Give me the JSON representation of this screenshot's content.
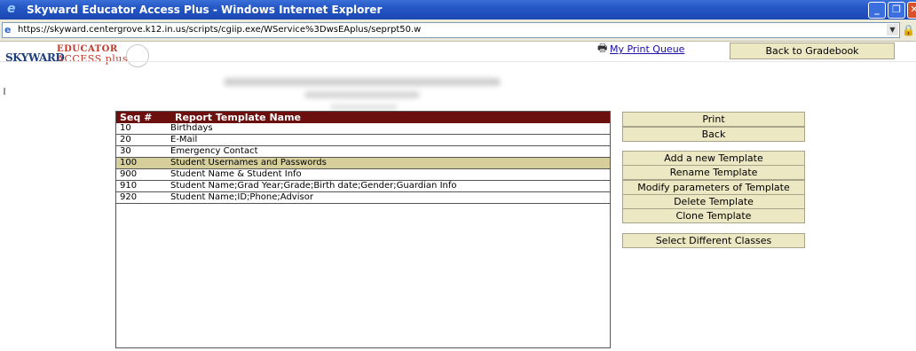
{
  "window": {
    "title": "Skyward Educator Access Plus - Windows Internet Explorer",
    "url": "https://skyward.centergrove.k12.in.us/scripts/cgiip.exe/WService%3DwsEAplus/seprpt50.w"
  },
  "logo": {
    "brand": "SKYWARD",
    "line1": "EDUCATOR",
    "line2": "ACCESS plus"
  },
  "header": {
    "print_queue_label": "My Print Queue",
    "back_to_gradebook_label": "Back to Gradebook"
  },
  "table": {
    "columns": [
      "Seq #",
      "Report Template Name"
    ],
    "rows": [
      {
        "seq": "10",
        "name": "Birthdays"
      },
      {
        "seq": "20",
        "name": "E-Mail"
      },
      {
        "seq": "30",
        "name": "Emergency Contact"
      },
      {
        "seq": "100",
        "name": "Student Usernames and Passwords"
      },
      {
        "seq": "900",
        "name": "Student Name & Student Info"
      },
      {
        "seq": "910",
        "name": "Student Name;Grad Year;Grade;Birth date;Gender;Guardian Info"
      },
      {
        "seq": "920",
        "name": "Student Name;ID;Phone;Advisor"
      }
    ],
    "selected_index": 3
  },
  "actions": {
    "print": "Print",
    "back": "Back",
    "add_template": "Add a new Template",
    "rename_template": "Rename Template",
    "modify_parameters": "Modify parameters of Template",
    "delete_template": "Delete Template",
    "clone_template": "Clone Template",
    "select_classes": "Select Different Classes"
  },
  "colors": {
    "table_header": "#6b0f0f",
    "selected_row": "#d6cf9c",
    "button_bg": "#ede8c4",
    "link": "#1a0dab"
  }
}
